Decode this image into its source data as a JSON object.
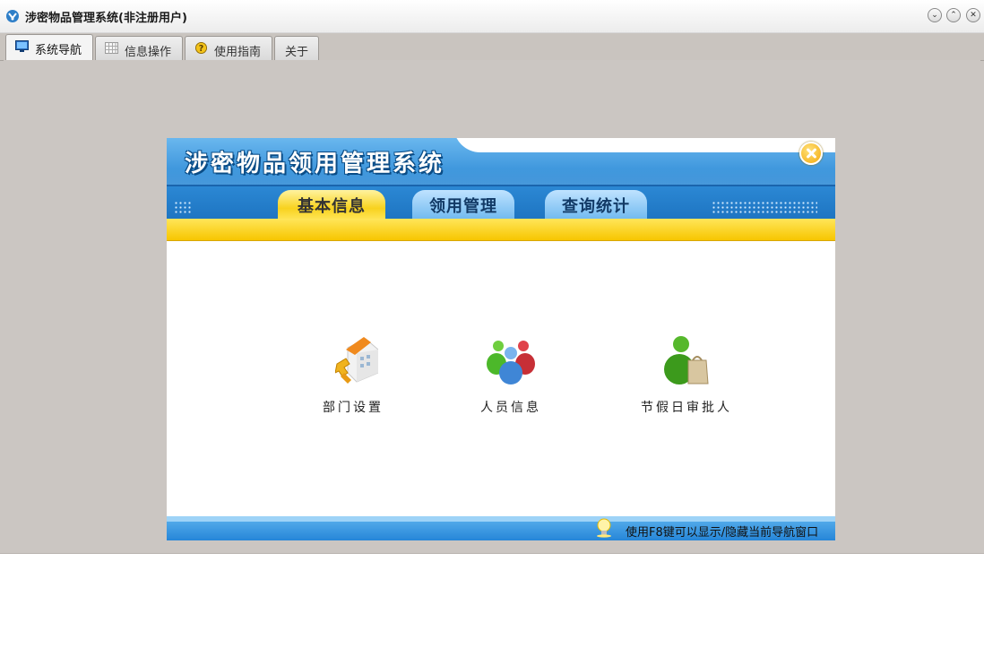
{
  "window": {
    "title": "涉密物品管理系统(非注册用户)",
    "controls": [
      "minimize",
      "restore",
      "close"
    ]
  },
  "tabs": [
    {
      "label": "系统导航",
      "icon": "monitor-icon",
      "active": true
    },
    {
      "label": "信息操作",
      "icon": "grid-icon",
      "active": false
    },
    {
      "label": "使用指南",
      "icon": "help-icon",
      "active": false
    },
    {
      "label": "关于",
      "icon": "",
      "active": false
    }
  ],
  "panel": {
    "title": "涉密物品领用管理系统",
    "nav_tabs": [
      {
        "label": "基本信息",
        "active": true
      },
      {
        "label": "领用管理",
        "active": false
      },
      {
        "label": "查询统计",
        "active": false
      }
    ],
    "items": [
      {
        "label": "部门设置",
        "icon": "department-building-icon"
      },
      {
        "label": "人员信息",
        "icon": "people-group-icon"
      },
      {
        "label": "节假日审批人",
        "icon": "approver-icon"
      }
    ],
    "footer_hint": "使用F8键可以显示/隐藏当前导航窗口"
  },
  "colors": {
    "window_bg": "#cbc6c2",
    "header_blue": "#2d8ad6",
    "nav_yellow": "#f8d21e"
  }
}
